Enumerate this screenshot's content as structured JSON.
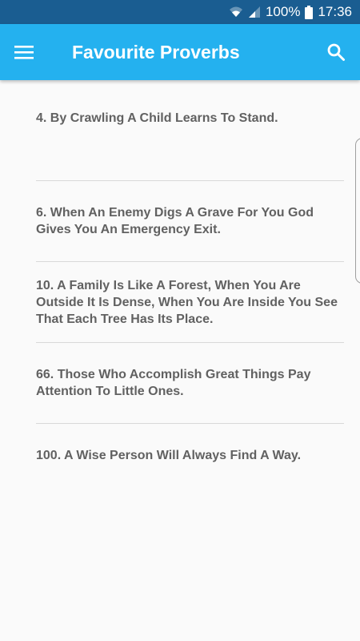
{
  "status_bar": {
    "battery": "100%",
    "time": "17:36"
  },
  "app_bar": {
    "title": "Favourite Proverbs",
    "menu_icon": "hamburger-menu-icon",
    "search_icon": "search-icon"
  },
  "proverbs": [
    "4. By Crawling A Child Learns To Stand.",
    "6. When An Enemy Digs A Grave For You God Gives You An Emergency Exit.",
    "10. A Family Is Like A Forest, When You Are Outside It Is Dense, When You Are Inside You See That Each Tree Has Its Place.",
    "66. Those Who Accomplish Great Things Pay Attention To Little Ones.",
    "100. A Wise Person Will Always Find A Way."
  ],
  "colors": {
    "status_bar": "#1a5d91",
    "app_bar": "#24b1ef",
    "text": "#616161",
    "background": "#fafafa"
  }
}
